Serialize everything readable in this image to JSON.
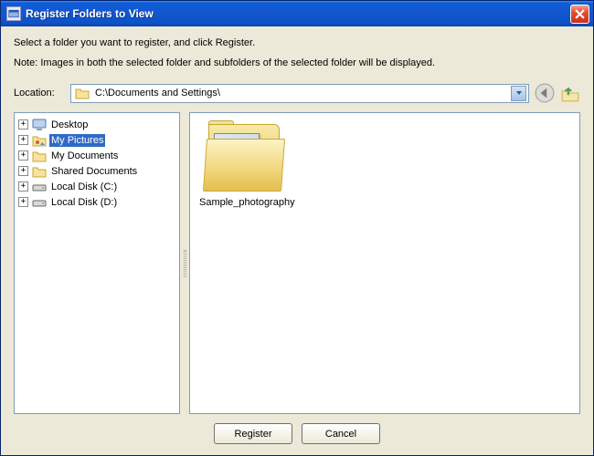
{
  "window": {
    "title": "Register Folders to View"
  },
  "text": {
    "instruction": "Select a folder you want to register, and click Register.",
    "note": "Note: Images in both the selected folder and subfolders of the selected folder will be displayed.",
    "location_label": "Location:"
  },
  "location": {
    "path": "C:\\Documents and Settings\\"
  },
  "tree": {
    "items": [
      {
        "label": "Desktop",
        "icon": "desktop",
        "expandable": true,
        "selected": false
      },
      {
        "label": "My Pictures",
        "icon": "pictures",
        "expandable": true,
        "selected": true
      },
      {
        "label": "My Documents",
        "icon": "folder",
        "expandable": true,
        "selected": false
      },
      {
        "label": "Shared Documents",
        "icon": "folder",
        "expandable": true,
        "selected": false
      },
      {
        "label": "Local Disk (C:)",
        "icon": "drive",
        "expandable": true,
        "selected": false
      },
      {
        "label": "Local Disk (D:)",
        "icon": "drive",
        "expandable": true,
        "selected": false
      }
    ]
  },
  "view": {
    "items": [
      {
        "label": "Sample_photography",
        "type": "folder-with-thumb"
      }
    ]
  },
  "buttons": {
    "register": "Register",
    "cancel": "Cancel"
  },
  "icons": {
    "plus": "+"
  }
}
